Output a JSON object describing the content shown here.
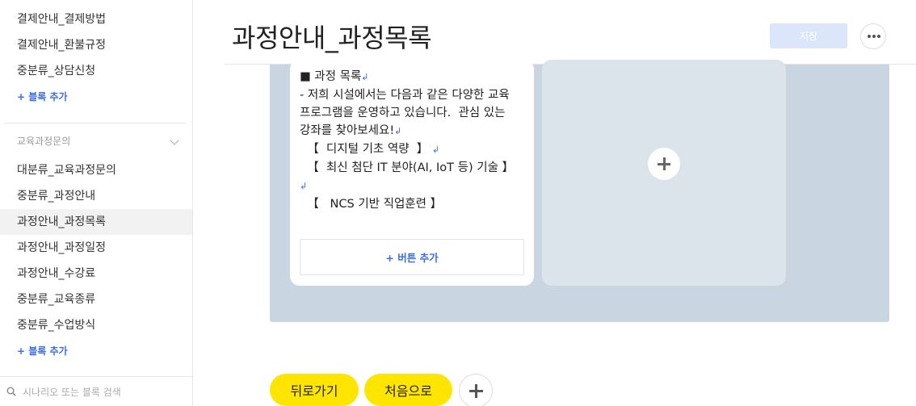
{
  "sidebar": {
    "top_items": [
      "결제안내_결제방법",
      "결제안내_환불규정",
      "중분류_상담신청"
    ],
    "add_block_label": "+ 블록 추가",
    "group_title": "교육과정문의",
    "group_items": [
      "대분류_교육과정문의",
      "중분류_과정안내",
      "과정안내_과정목록",
      "과정안내_과정일정",
      "과정안내_수강료",
      "중분류_교육종류",
      "중분류_수업방식"
    ],
    "active_item": "과정안내_과정목록",
    "search_placeholder": "시나리오 또는 블록 검색"
  },
  "header": {
    "title": "과정안내_과정목록",
    "save_label": "저장"
  },
  "card": {
    "lines": [
      {
        "text": "■ 과정 목록",
        "return": true
      },
      {
        "text": "- 저희 시설에서는 다음과 같은 다양한 교육 프로그램을 운영하고 있습니다.  관심 있는 강좌를 찾아보세요!",
        "return": true
      },
      {
        "text": "  【  디지털 기초 역량  】",
        "return": true
      },
      {
        "text": "  【  최신 첨단 IT 분야(AI, IoT 등) 기술 】",
        "return": true
      },
      {
        "text": "  【   NCS 기반 직업훈련 】",
        "return": false
      }
    ],
    "add_button_label": "+ 버튼 추가"
  },
  "quick_replies": {
    "back_label": "뒤로가기",
    "home_label": "처음으로"
  },
  "colors": {
    "accent_blue": "#3a6ee8",
    "canvas_bg": "#c9d5e0",
    "quick_reply_yellow": "#fee500",
    "save_button_disabled": "#dbe6fb"
  }
}
